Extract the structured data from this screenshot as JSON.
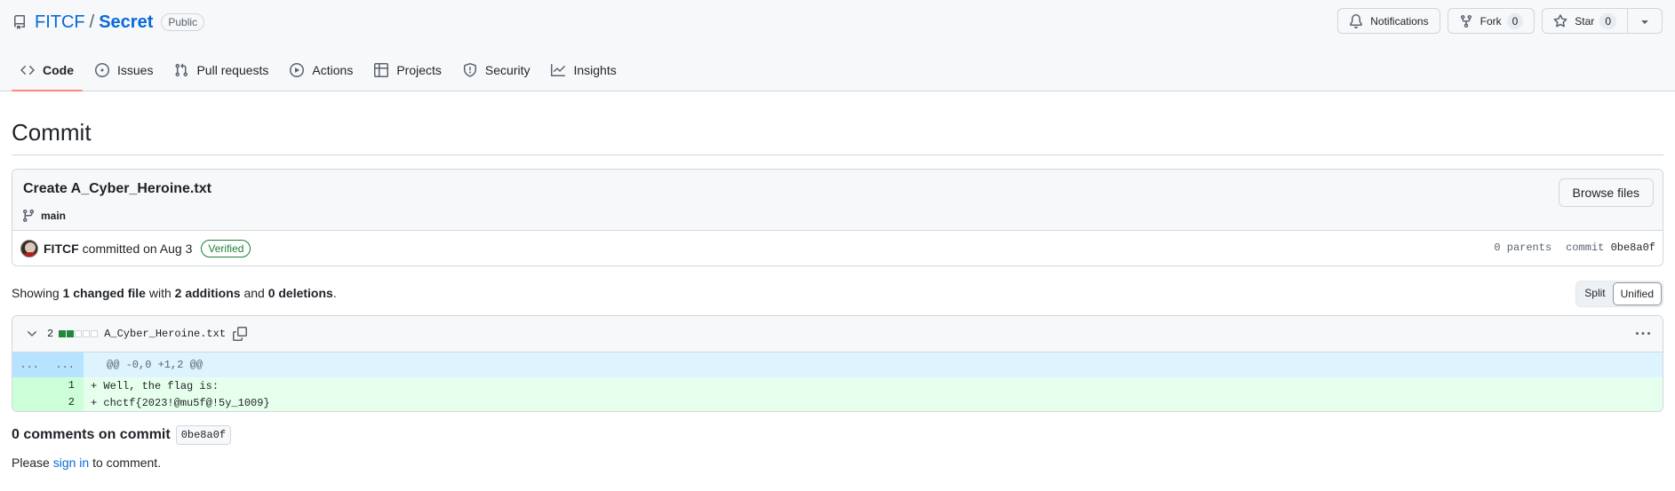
{
  "repo": {
    "owner": "FITCF",
    "separator": "/",
    "name": "Secret",
    "visibility": "Public"
  },
  "actions": {
    "notifications": "Notifications",
    "fork": "Fork",
    "fork_count": "0",
    "star": "Star",
    "star_count": "0"
  },
  "tabs": [
    {
      "label": "Code",
      "icon": "code-icon",
      "active": true
    },
    {
      "label": "Issues",
      "icon": "issue-icon"
    },
    {
      "label": "Pull requests",
      "icon": "pull-request-icon"
    },
    {
      "label": "Actions",
      "icon": "play-icon"
    },
    {
      "label": "Projects",
      "icon": "table-icon"
    },
    {
      "label": "Security",
      "icon": "shield-icon"
    },
    {
      "label": "Insights",
      "icon": "graph-icon"
    }
  ],
  "page_title": "Commit",
  "commit": {
    "message": "Create A_Cyber_Heroine.txt",
    "branch": "main",
    "browse_files": "Browse files",
    "author": "FITCF",
    "committed_text": "committed on Aug 3",
    "verified": "Verified",
    "parents": "0 parents",
    "commit_label": "commit",
    "sha": "0be8a0f"
  },
  "summary": {
    "showing": "Showing",
    "changed_files": "1 changed file",
    "with": "with",
    "additions": "2 additions",
    "and": "and",
    "deletions": "0 deletions",
    "period": "."
  },
  "view_toggle": {
    "split": "Split",
    "unified": "Unified",
    "selected": "Unified"
  },
  "diff": {
    "count": "2",
    "filename": "A_Cyber_Heroine.txt",
    "hunk_left": "...",
    "hunk_right": "...",
    "hunk_header": "@@ -0,0 +1,2 @@",
    "lines": [
      {
        "num": "1",
        "text": "+ Well, the flag is:"
      },
      {
        "num": "2",
        "text": "+ chctf{2023!@mu5f@!5y_1009}"
      }
    ]
  },
  "comments": {
    "title": "0 comments on commit",
    "sha": "0be8a0f",
    "please": "Please",
    "sign_in": "sign in",
    "to_comment": "to comment."
  },
  "colors": {
    "link": "#0969da",
    "active_tab": "#fd8c73",
    "added_bg": "#e6ffec",
    "hunk_bg": "#ddf4ff",
    "verified": "#1a7f37"
  }
}
